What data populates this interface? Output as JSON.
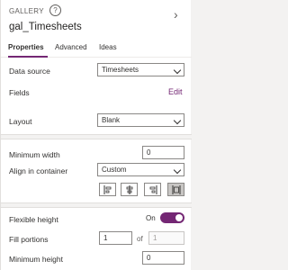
{
  "header": {
    "type_label": "GALLERY",
    "help_glyph": "?",
    "control_name": "gal_Timesheets",
    "chevron": "›"
  },
  "tabs": [
    {
      "label": "Properties",
      "active": true
    },
    {
      "label": "Advanced",
      "active": false
    },
    {
      "label": "Ideas",
      "active": false
    }
  ],
  "data_source": {
    "label": "Data source",
    "value": "Timesheets"
  },
  "fields": {
    "label": "Fields",
    "action": "Edit"
  },
  "layout": {
    "label": "Layout",
    "value": "Blank"
  },
  "minimum_width": {
    "label": "Minimum width",
    "value": "0"
  },
  "align": {
    "label": "Align in container",
    "value": "Custom",
    "buttons": [
      {
        "icon": "align-start-icon",
        "selected": false
      },
      {
        "icon": "align-center-icon",
        "selected": false
      },
      {
        "icon": "align-end-icon",
        "selected": false
      },
      {
        "icon": "align-stretch-icon",
        "selected": true
      }
    ]
  },
  "flexible_height": {
    "label": "Flexible height",
    "state_label": "On",
    "on": true
  },
  "fill_portions": {
    "label": "Fill portions",
    "value": "1",
    "of_label": "of",
    "total": "1"
  },
  "minimum_height": {
    "label": "Minimum height",
    "value": "0"
  },
  "colors": {
    "accent": "#742774",
    "selected_button": "#c8c6c4",
    "divider": "#f3f2f1"
  }
}
